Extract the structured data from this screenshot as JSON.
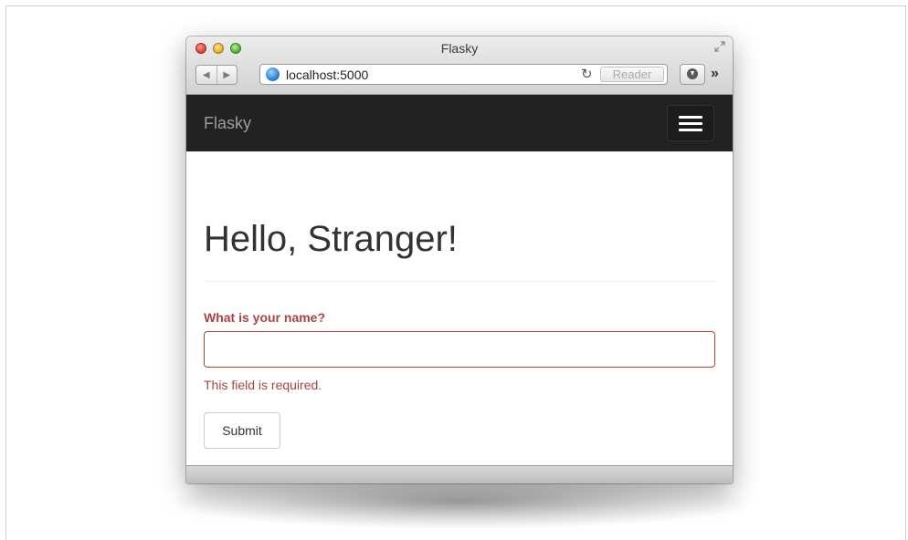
{
  "window": {
    "title": "Flasky"
  },
  "toolbar": {
    "back_icon": "◀",
    "forward_icon": "▶",
    "url": "localhost:5000",
    "reload_icon": "↻",
    "reader_label": "Reader",
    "more_icon": "»"
  },
  "navbar": {
    "brand": "Flasky"
  },
  "page": {
    "heading": "Hello, Stranger!",
    "form": {
      "name_label": "What is your name?",
      "name_value": "",
      "error_text": "This field is required.",
      "submit_label": "Submit"
    }
  },
  "colors": {
    "navbar_bg": "#222222",
    "brand_text": "#9d9d9d",
    "error": "#a94442",
    "heading": "#333333"
  }
}
